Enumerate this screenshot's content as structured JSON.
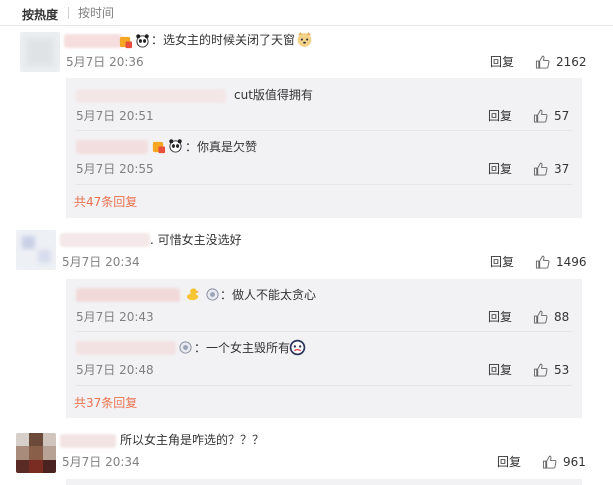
{
  "sort": {
    "hot_label": "按热度",
    "time_label": "按时间"
  },
  "reply_label": "回复",
  "comments": [
    {
      "text": "：选女主的时候关闭了天窗",
      "time": "5月7日 20:36",
      "likes": "2162",
      "replies": [
        {
          "text": "cut版值得拥有",
          "time": "5月7日 20:51",
          "likes": "57"
        },
        {
          "text": "：你真是欠赞",
          "time": "5月7日 20:55",
          "likes": "37"
        }
      ],
      "more": "共47条回复"
    },
    {
      "text": ". 可惜女主没选好",
      "time": "5月7日 20:34",
      "likes": "1496",
      "replies": [
        {
          "text": "：做人不能太贪心",
          "time": "5月7日 20:43",
          "likes": "88"
        },
        {
          "text": "：一个女主毁所有",
          "time": "5月7日 20:48",
          "likes": "53"
        }
      ],
      "more": "共37条回复"
    },
    {
      "text": "所以女主角是咋选的？？？",
      "time": "5月7日 20:34",
      "likes": "961"
    }
  ]
}
